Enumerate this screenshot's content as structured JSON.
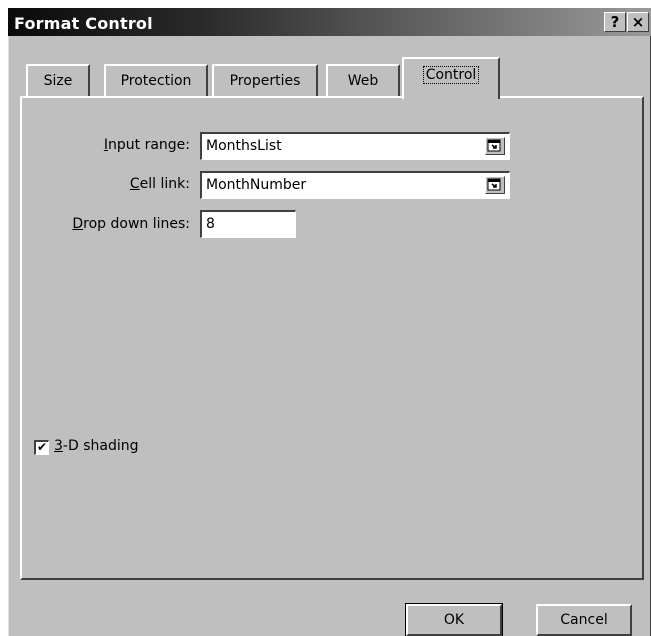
{
  "titlebar": {
    "title": "Format Control",
    "help_label": "?",
    "close_label": "×"
  },
  "tabs": [
    {
      "label": "Size",
      "active": false
    },
    {
      "label": "Protection",
      "active": false
    },
    {
      "label": "Properties",
      "active": false
    },
    {
      "label": "Web",
      "active": false
    },
    {
      "label": "Control",
      "active": true
    }
  ],
  "form": {
    "input_range": {
      "label_accel": "I",
      "label_rest": "nput range:",
      "value": "MonthsList"
    },
    "cell_link": {
      "label_accel": "C",
      "label_rest": "ell link:",
      "value": "MonthNumber"
    },
    "drop_down_lines": {
      "label_accel": "D",
      "label_rest": "rop down lines:",
      "value": "8"
    }
  },
  "shading": {
    "checked": true,
    "check_mark": "✔",
    "label_accel": "3",
    "label_rest": "-D shading"
  },
  "buttons": {
    "ok": "OK",
    "cancel": "Cancel"
  }
}
